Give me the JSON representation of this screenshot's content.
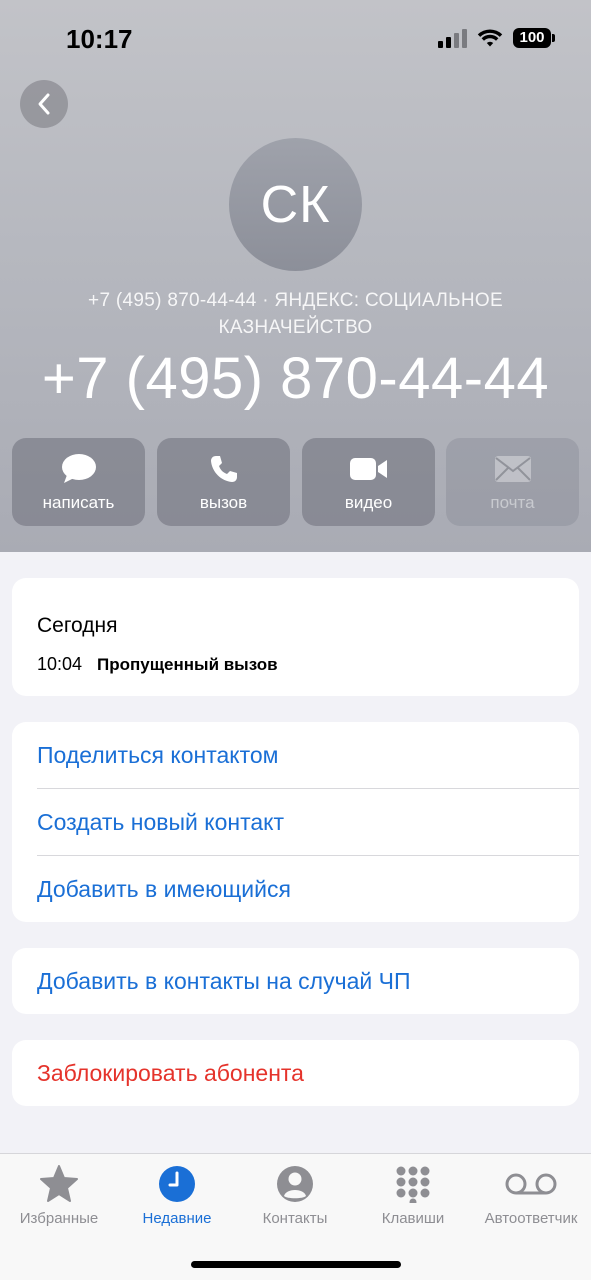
{
  "status": {
    "time": "10:17",
    "battery": "100"
  },
  "contact": {
    "initials": "СК",
    "subtitle": "+7 (495) 870-44-44 · ЯНДЕКС: СОЦИАЛЬНОЕ КАЗНАЧЕЙСТВО",
    "phone": "+7 (495) 870-44-44"
  },
  "actions": [
    {
      "label": "написать",
      "icon": "message-bubble-icon"
    },
    {
      "label": "вызов",
      "icon": "phone-icon"
    },
    {
      "label": "видео",
      "icon": "video-camera-icon"
    },
    {
      "label": "почта",
      "icon": "envelope-icon"
    }
  ],
  "recent": {
    "heading": "Сегодня",
    "time": "10:04",
    "status": "Пропущенный вызов"
  },
  "options": {
    "share": "Поделиться контактом",
    "create": "Создать новый контакт",
    "add_existing": "Добавить в имеющийся",
    "emergency": "Добавить в контакты на случай ЧП",
    "block": "Заблокировать абонента"
  },
  "tabs": [
    {
      "label": "Избранные",
      "icon": "star-icon"
    },
    {
      "label": "Недавние",
      "icon": "clock-icon"
    },
    {
      "label": "Контакты",
      "icon": "person-circle-icon"
    },
    {
      "label": "Клавиши",
      "icon": "keypad-icon"
    },
    {
      "label": "Автоответчик",
      "icon": "voicemail-icon"
    }
  ],
  "colors": {
    "accent": "#1a6fd6",
    "destructive": "#e5332b",
    "tab_inactive": "#8e8e93"
  }
}
